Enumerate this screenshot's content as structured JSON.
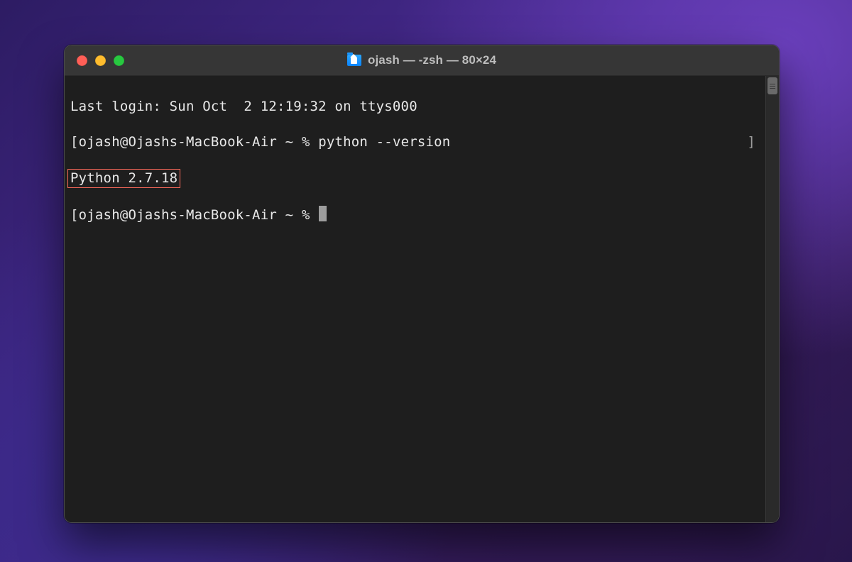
{
  "window": {
    "title": "ojash — -zsh — 80×24"
  },
  "terminal": {
    "last_login": "Last login: Sun Oct  2 12:19:32 on ttys000",
    "prompt_user_host": "ojash@Ojashs-MacBook-Air",
    "prompt_path": "~",
    "prompt_symbol": "%",
    "command": "python --version",
    "output_highlighted": "Python 2.7.18"
  },
  "colors": {
    "window_bg": "#1e1e1e",
    "titlebar_bg": "#363636",
    "text": "#e8e8e8",
    "highlight_border": "#ff6a5b",
    "traffic_red": "#ff5f57",
    "traffic_yellow": "#febc2e",
    "traffic_green": "#28c840"
  }
}
